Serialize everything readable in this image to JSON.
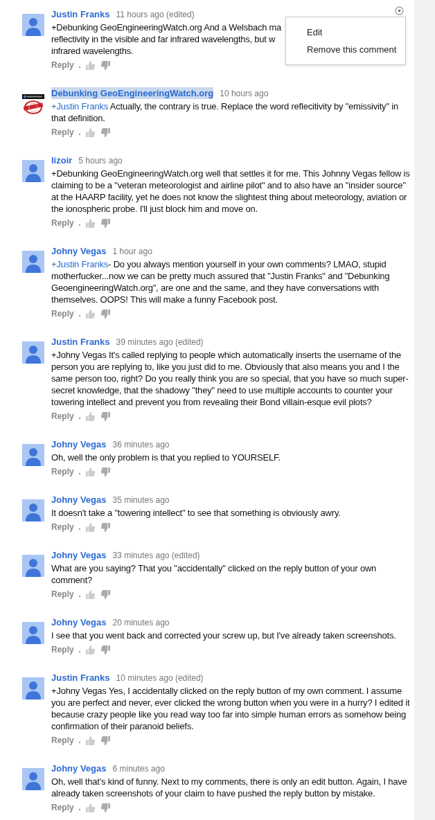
{
  "comments": [
    {
      "author": "Justin Franks",
      "time": "11 hours ago (edited)",
      "kind": "default",
      "highlighted": false,
      "body_lines": [
        "+Debunking GeoEngineeringWatch.org And a Welsbach ma",
        "reflectivity in the visible and far infrared wavelengths, but w",
        "infrared wavelengths."
      ],
      "reply": "Reply"
    },
    {
      "author": "Debunking GeoEngineeringWatch.org",
      "time": "10 hours ago",
      "kind": "logo",
      "highlighted": true,
      "mention": "+Justin Franks",
      "body": " Actually, the contrary is true. Replace the word reflecitivity by \"emissivity\" in that definition.",
      "reply": "Reply"
    },
    {
      "author": "lizoir",
      "time": "5 hours ago",
      "kind": "default",
      "highlighted": false,
      "body": "+Debunking GeoEngineeringWatch.org well that settles it for me. This Johnny Vegas fellow is claiming to be a \"veteran meteorologist and airline pilot\" and to also have an \"insider source\" at the HAARP facility, yet he does not know the slightest thing about meteorology, aviation or the ionospheric probe.  I'll just block him and move on.",
      "reply": "Reply"
    },
    {
      "author": "Johny Vegas",
      "time": "1 hour ago",
      "kind": "default",
      "highlighted": false,
      "mention": "+Justin Franks",
      "body": "- Do you always mention yourself in your own comments? LMAO, stupid motherfucker...now we can be pretty much assured that \"Justin Franks\" and \"Debunking GeoengineeringWatch.org\", are one and the same, and they have conversations with themselves. OOPS! This will make a funny Facebook post.",
      "reply": "Reply"
    },
    {
      "author": "Justin Franks",
      "time": "39 minutes ago (edited)",
      "kind": "default",
      "highlighted": false,
      "body": "+Johny Vegas It's called replying to people which automatically inserts the username of the person you are replying to, like you just did to me. Obviously that also means you and I the same person too, right? Do you really think you are so special, that you have so much super-secret knowledge, that the shadowy \"they\" need to use multiple accounts to counter your towering intellect and prevent you from revealing their Bond villain-esque evil plots?",
      "reply": "Reply"
    },
    {
      "author": "Johny Vegas",
      "time": "36 minutes ago",
      "kind": "default",
      "highlighted": false,
      "body": "Oh, well the only problem is that you replied to YOURSELF.",
      "reply": "Reply"
    },
    {
      "author": "Johny Vegas",
      "time": "35 minutes ago",
      "kind": "default",
      "highlighted": false,
      "body": "It doesn't take a \"towering intellect\" to see that something is obviously awry.",
      "reply": "Reply"
    },
    {
      "author": "Johny Vegas",
      "time": "33 minutes ago (edited)",
      "kind": "default",
      "highlighted": false,
      "body": "What are you saying? That you \"accidentally\" clicked on the reply button of your own comment?",
      "reply": "Reply"
    },
    {
      "author": "Johny Vegas",
      "time": "20 minutes ago",
      "kind": "default",
      "highlighted": false,
      "body": "I see that you went back and corrected your screw up, but I've already taken screenshots.",
      "reply": "Reply"
    },
    {
      "author": "Justin Franks",
      "time": "10 minutes ago (edited)",
      "kind": "default",
      "highlighted": false,
      "body": "+Johny Vegas Yes, I accidentally clicked on the reply button of my own comment. I assume you are perfect and never, ever clicked the wrong button when you were in a hurry? I edited it because crazy people like you read way too far into simple human errors as somehow being confirmation of their paranoid beliefs.",
      "reply": "Reply"
    },
    {
      "author": "Johny Vegas",
      "time": "6 minutes ago",
      "kind": "default",
      "highlighted": false,
      "body": "Oh, well that's kind of funny. Next to my comments, there is only an edit button. Again, I have already taken screenshots of your claim to have pushed the reply button by mistake.",
      "reply": "Reply"
    }
  ],
  "menu": {
    "items": [
      "Edit",
      "Remove this comment"
    ]
  }
}
